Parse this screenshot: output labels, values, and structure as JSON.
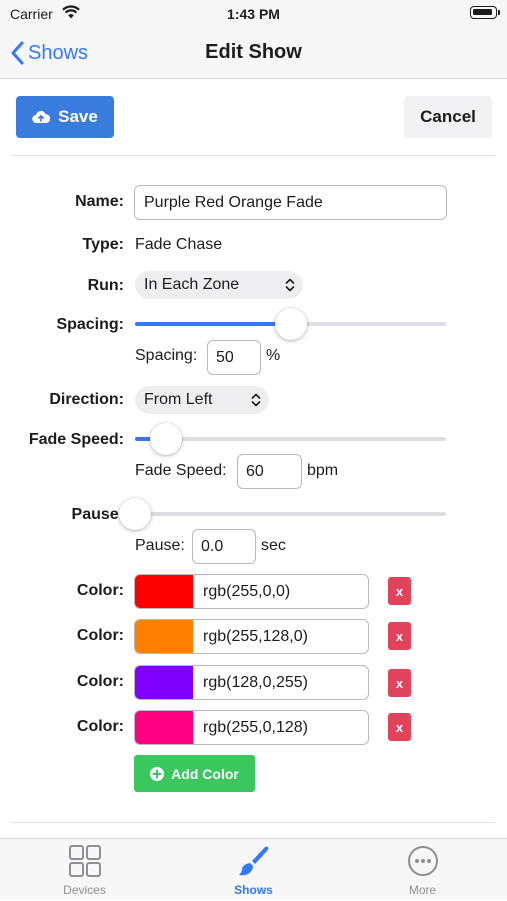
{
  "status_bar": {
    "carrier": "Carrier",
    "time": "1:43 PM"
  },
  "nav": {
    "back_label": "Shows",
    "title": "Edit Show"
  },
  "toolbar": {
    "save_label": "Save",
    "cancel_label": "Cancel"
  },
  "form": {
    "name": {
      "label": "Name:",
      "value": "Purple Red Orange Fade"
    },
    "type": {
      "label": "Type:",
      "value": "Fade Chase"
    },
    "run": {
      "label": "Run:",
      "value": "In Each Zone"
    },
    "spacing": {
      "label": "Spacing:",
      "slider_fraction": 0.5,
      "input_label": "Spacing:",
      "value": "50",
      "unit": "%"
    },
    "direction": {
      "label": "Direction:",
      "value": "From Left"
    },
    "fade_speed": {
      "label": "Fade Speed:",
      "slider_fraction": 0.1,
      "input_label": "Fade Speed:",
      "value": "60",
      "unit": "bpm"
    },
    "pause": {
      "label": "Pause:",
      "slider_fraction": 0.0,
      "input_label": "Pause:",
      "value": "0.0",
      "unit": "sec"
    },
    "colors": [
      {
        "label": "Color:",
        "value": "rgb(255,0,0)",
        "swatch": "#ff0000",
        "delete_label": "x"
      },
      {
        "label": "Color:",
        "value": "rgb(255,128,0)",
        "swatch": "#ff8000",
        "delete_label": "x"
      },
      {
        "label": "Color:",
        "value": "rgb(128,0,255)",
        "swatch": "#8000ff",
        "delete_label": "x"
      },
      {
        "label": "Color:",
        "value": "rgb(255,0,128)",
        "swatch": "#ff0080",
        "delete_label": "x"
      }
    ],
    "add_color_label": "Add Color"
  },
  "tabs": [
    {
      "label": "Devices",
      "icon": "grid-icon",
      "active": false
    },
    {
      "label": "Shows",
      "icon": "paintbrush-icon",
      "active": true
    },
    {
      "label": "More",
      "icon": "ellipsis-circle-icon",
      "active": false
    }
  ],
  "colors": {
    "accent": "#3478f6",
    "save": "#3a7bde",
    "add": "#3ac75e",
    "delete": "#e0435a"
  }
}
